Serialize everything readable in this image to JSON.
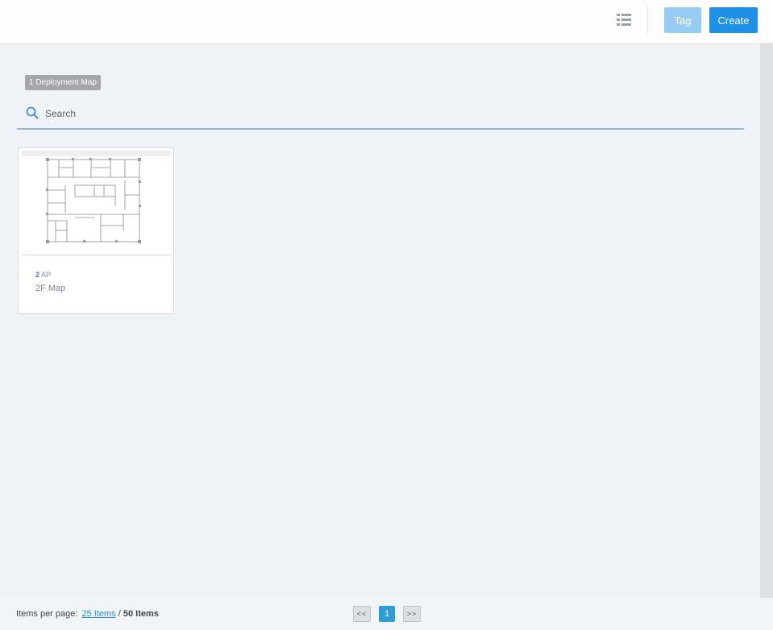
{
  "toolbar": {
    "list_view_icon": "list-view-icon",
    "tag_label": "Tag",
    "create_label": "Create",
    "tag_color": "#97cdf5",
    "create_color": "#1e90e6"
  },
  "content": {
    "count_badge": "1 Deployment Map",
    "search": {
      "placeholder": "Search",
      "value": "",
      "icon": "search-icon"
    },
    "maps": [
      {
        "ap_count": "2",
        "ap_label": "AP",
        "name": "2F Map",
        "thumbnail_icon": "floorplan-thumbnail"
      }
    ]
  },
  "footer": {
    "per_page_label": "Items per page:",
    "per_page_value": "25 Items",
    "separator": "/",
    "total": "50 Items",
    "pager": {
      "prev": "<<",
      "current": "1",
      "next": ">>"
    },
    "accent_color": "#2d9ed8"
  }
}
